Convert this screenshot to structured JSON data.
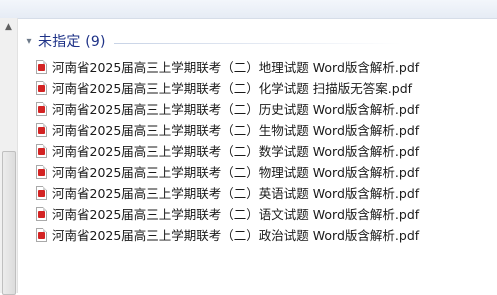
{
  "group": {
    "title": "未指定 (9)"
  },
  "files": [
    {
      "name": "河南省2025届高三上学期联考（二）地理试题 Word版含解析.pdf"
    },
    {
      "name": "河南省2025届高三上学期联考（二）化学试题 扫描版无答案.pdf"
    },
    {
      "name": "河南省2025届高三上学期联考（二）历史试题 Word版含解析.pdf"
    },
    {
      "name": "河南省2025届高三上学期联考（二）生物试题 Word版含解析.pdf"
    },
    {
      "name": "河南省2025届高三上学期联考（二）数学试题 Word版含解析.pdf"
    },
    {
      "name": "河南省2025届高三上学期联考（二）物理试题 Word版含解析.pdf"
    },
    {
      "name": "河南省2025届高三上学期联考（二）英语试题 Word版含解析.pdf"
    },
    {
      "name": "河南省2025届高三上学期联考（二）语文试题 Word版含解析.pdf"
    },
    {
      "name": "河南省2025届高三上学期联考（二）政治试题 Word版含解析.pdf"
    }
  ]
}
